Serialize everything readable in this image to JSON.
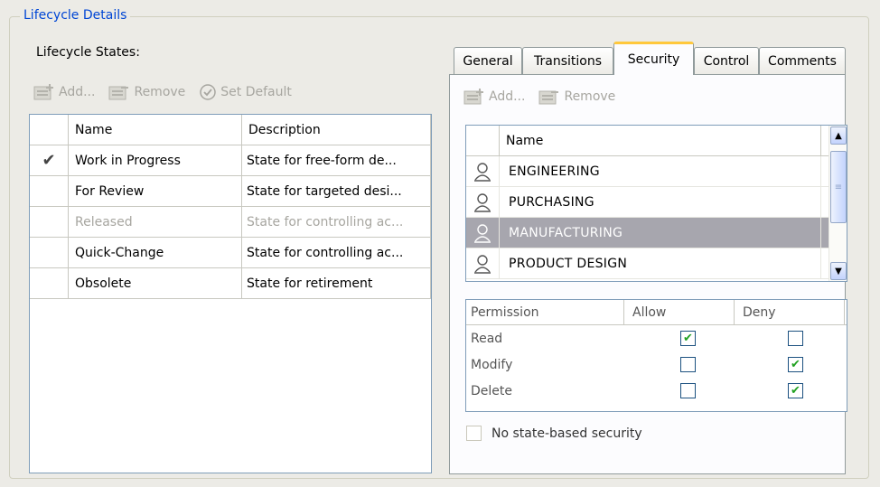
{
  "group_title": "Lifecycle Details",
  "states_label": "Lifecycle States:",
  "left_toolbar": {
    "add": "Add...",
    "remove": "Remove",
    "set_default": "Set Default"
  },
  "states_table": {
    "columns": [
      "Name",
      "Description"
    ],
    "rows": [
      {
        "default": true,
        "name": "Work in Progress",
        "description": "State for free-form de...",
        "enabled": true
      },
      {
        "default": false,
        "name": "For Review",
        "description": "State for targeted desi...",
        "enabled": true
      },
      {
        "default": false,
        "name": "Released",
        "description": "State for controlling ac...",
        "enabled": false
      },
      {
        "default": false,
        "name": "Quick-Change",
        "description": "State for controlling ac...",
        "enabled": true
      },
      {
        "default": false,
        "name": "Obsolete",
        "description": "State for retirement",
        "enabled": true
      }
    ]
  },
  "tabs": [
    {
      "label": "General",
      "active": false
    },
    {
      "label": "Transitions",
      "active": false
    },
    {
      "label": "Security",
      "active": true
    },
    {
      "label": "Control",
      "active": false
    },
    {
      "label": "Comments",
      "active": false
    }
  ],
  "right_toolbar": {
    "add": "Add...",
    "remove": "Remove"
  },
  "members_table": {
    "columns": [
      "Name"
    ],
    "rows": [
      {
        "name": "ENGINEERING",
        "selected": false
      },
      {
        "name": "PURCHASING",
        "selected": false
      },
      {
        "name": "MANUFACTURING",
        "selected": true
      },
      {
        "name": "PRODUCT DESIGN",
        "selected": false
      }
    ]
  },
  "permissions": {
    "columns": [
      "Permission",
      "Allow",
      "Deny"
    ],
    "rows": [
      {
        "name": "Read",
        "allow": true,
        "deny": false
      },
      {
        "name": "Modify",
        "allow": false,
        "deny": true
      },
      {
        "name": "Delete",
        "allow": false,
        "deny": true
      }
    ]
  },
  "no_state_security": {
    "label": "No state-based security",
    "checked": false
  },
  "colors": {
    "accent": "#0046d5",
    "tab_highlight": "#ffc83c",
    "selection": "#a7a6ae",
    "check": "#21a121"
  },
  "icons": {
    "check": "checkmark-icon",
    "user": "user-icon",
    "add": "add-icon",
    "remove": "remove-icon",
    "set_default": "set-default-icon"
  }
}
